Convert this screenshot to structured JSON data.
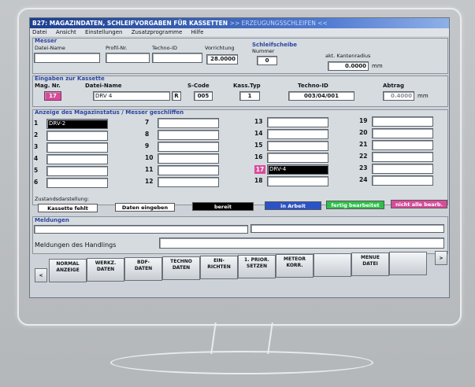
{
  "window": {
    "title_main": "B27: MAGAZINDATEN, SCHLEIFVORGABEN FÜR KASSETTEN",
    "title_dim": ">> ERZEUGUNGSSCHLEIFEN <<"
  },
  "menu": [
    "Datei",
    "Ansicht",
    "Einstellungen",
    "Zusatzprogramme",
    "Hilfe"
  ],
  "messer": {
    "group_title": "Messer",
    "labels": {
      "dateiname": "Datei-Name",
      "profil": "Profil-Nr.",
      "techno": "Techno-ID",
      "vorrichtung": "Vorrichtung"
    },
    "values": {
      "dateiname": "",
      "profil": "",
      "techno": "",
      "vorrichtung": "28.0000"
    }
  },
  "schleifscheibe": {
    "group_title": "Schleifscheibe",
    "nummer_label": "Nummer",
    "nummer": "0",
    "kantenradius_label": "akt. Kantenradius",
    "kantenradius": "0.0000",
    "unit": "mm"
  },
  "eingaben": {
    "group_title": "Eingaben zur Kassette",
    "labels": {
      "mag_nr": "Mag. Nr.",
      "dateiname": "Datei-Name",
      "scode": "S-Code",
      "kass_typ": "Kass.Typ",
      "techno": "Techno-ID",
      "abtrag": "Abtrag"
    },
    "values": {
      "mag_nr": "17",
      "dateiname": "DRV 4",
      "r": "R",
      "scode": "005",
      "kass_typ": "1",
      "techno": "003/04/001",
      "abtrag": "0.4000"
    },
    "unit": "mm"
  },
  "magazin": {
    "group_title": "Anzeige des Magazinstatus / Messer geschliffen",
    "slots": [
      {
        "n": "1",
        "v": "DRV-2",
        "state": "black"
      },
      {
        "n": "2",
        "v": ""
      },
      {
        "n": "3",
        "v": ""
      },
      {
        "n": "4",
        "v": ""
      },
      {
        "n": "5",
        "v": ""
      },
      {
        "n": "6",
        "v": ""
      },
      {
        "n": "7",
        "v": ""
      },
      {
        "n": "8",
        "v": ""
      },
      {
        "n": "9",
        "v": ""
      },
      {
        "n": "10",
        "v": ""
      },
      {
        "n": "11",
        "v": ""
      },
      {
        "n": "12",
        "v": ""
      },
      {
        "n": "13",
        "v": ""
      },
      {
        "n": "14",
        "v": ""
      },
      {
        "n": "15",
        "v": ""
      },
      {
        "n": "16",
        "v": ""
      },
      {
        "n": "17",
        "v": "DRV-4",
        "state": "black",
        "numstate": "pink"
      },
      {
        "n": "18",
        "v": ""
      },
      {
        "n": "19",
        "v": ""
      },
      {
        "n": "20",
        "v": ""
      },
      {
        "n": "21",
        "v": ""
      },
      {
        "n": "22",
        "v": ""
      },
      {
        "n": "23",
        "v": ""
      },
      {
        "n": "24",
        "v": ""
      }
    ]
  },
  "zustand": {
    "label": "Zustandsdarstellung:",
    "items": [
      {
        "text": "Kassette fehlt",
        "bg": "#ffffff",
        "fg": "#000000"
      },
      {
        "text": "Daten eingeben",
        "bg": "#ffffff",
        "fg": "#000000"
      },
      {
        "text": "bereit",
        "bg": "#000000",
        "fg": "#ffffff"
      },
      {
        "text": "in Arbeit",
        "bg": "#2b53c8",
        "fg": "#ffffff"
      },
      {
        "text": "fertig bearbeitet",
        "bg": "#2fbf4a",
        "fg": "#ffffff"
      },
      {
        "text": "nicht alle bearb.",
        "bg": "#d84c9a",
        "fg": "#ffffff"
      }
    ]
  },
  "meldungen": {
    "group_title": "Meldungen",
    "handling_label": "Meldungen des Handlings"
  },
  "buttons": [
    {
      "l1": "NORMAL",
      "l2": "ANZEIGE"
    },
    {
      "l1": "WERKZ.",
      "l2": "DATEN"
    },
    {
      "l1": "BDF-",
      "l2": "DATEN"
    },
    {
      "l1": "TECHNO",
      "l2": "DATEN"
    },
    {
      "l1": "EIN-",
      "l2": "RICHTEN"
    },
    {
      "l1": "1. PRIOR.",
      "l2": "SETZEN"
    },
    {
      "l1": "METEOR",
      "l2": "KORR."
    },
    {
      "l1": "",
      "l2": ""
    },
    {
      "l1": "MENUE",
      "l2": "DATEI"
    },
    {
      "l1": "",
      "l2": ""
    }
  ],
  "nav": {
    "left": "<",
    "right": ">"
  },
  "colors": {
    "title_bar": "#1c3f8f",
    "pink": "#d84c9a",
    "blue": "#2b53c8",
    "green": "#2fbf4a"
  }
}
